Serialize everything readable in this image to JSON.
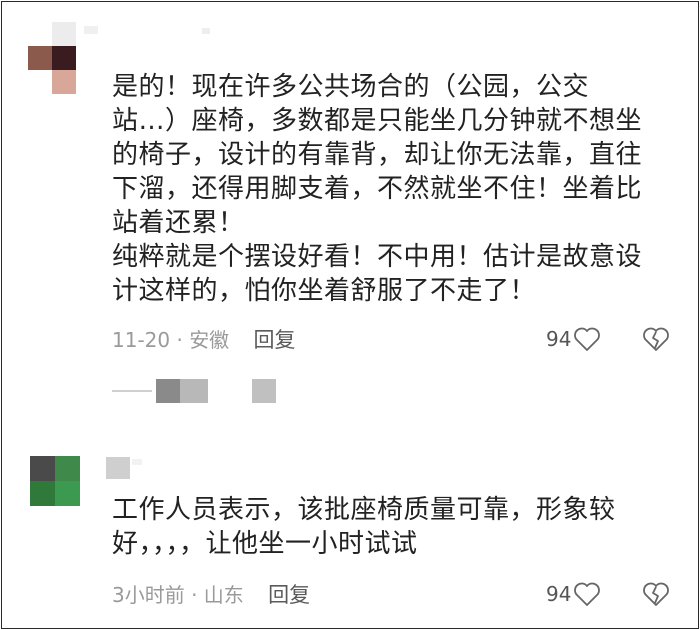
{
  "comments": [
    {
      "text_lines": [
        "是的！现在许多公共场合的（公园，公交",
        "站…）座椅，多数都是只能坐几分钟就不想坐",
        "的椅子，设计的有靠背，却让你无法靠，直往",
        "下溜，还得用脚支着，不然就坐不住！坐着比",
        "站着还累！",
        "纯粹就是个摆设好看！不中用！估计是故意设",
        "计这样的，怕你坐着舒服了不走了！"
      ],
      "meta": "11-20 · 安徽",
      "reply_label": "回复",
      "likes": "94"
    },
    {
      "text_lines": [
        "工作人员表示，该批座椅质量可靠，形象较",
        "好，，，，让他坐一小时试试"
      ],
      "meta": "3小时前 · 山东",
      "reply_label": "回复",
      "likes": "94"
    }
  ],
  "colors": {
    "avatar1": [
      "#ffffff",
      "#ececec",
      "#ffffff",
      "#8c5a4c",
      "#3a1c20",
      "#ffffff",
      "#ffffff",
      "#d9a79a",
      "#ffffff"
    ],
    "avatar2": [
      "#4a4a4a",
      "#3f8a4a",
      "#2f7a3a",
      "#3b9a4f"
    ]
  }
}
